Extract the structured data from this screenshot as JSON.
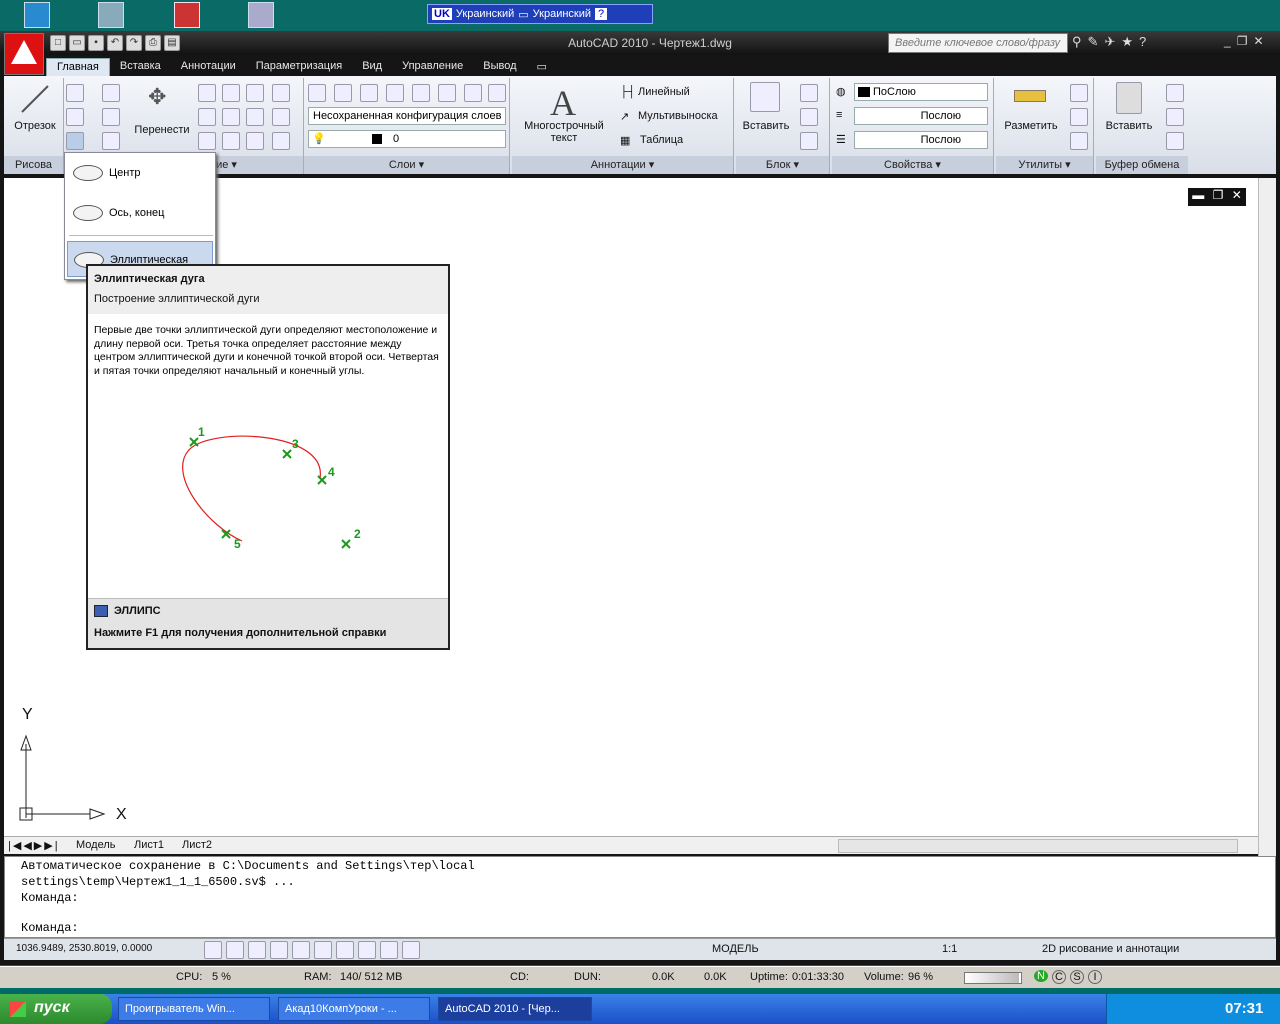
{
  "lang_bar": {
    "code": "UK",
    "label1": "Украинский",
    "label2": "Украинский",
    "help": "?"
  },
  "window": {
    "title": "AutoCAD 2010 - Чертеж1.dwg",
    "search_placeholder": "Введите ключевое слово/фразу",
    "min": "_",
    "restore": "❐",
    "close": "✕"
  },
  "tabs": [
    "Главная",
    "Вставка",
    "Аннотации",
    "Параметризация",
    "Вид",
    "Управление",
    "Вывод"
  ],
  "ribbon": {
    "draw": {
      "line": "Отрезок",
      "footer": "Рисова"
    },
    "modify": {
      "move": "Перенести",
      "footer": "ование ▾"
    },
    "layers": {
      "layer_state": "Несохраненная конфигурация слоев",
      "current_layer": "0",
      "footer": "Слои ▾"
    },
    "annotation": {
      "mtext": "Многострочный текст",
      "linear": "Линейный",
      "multileader": "Мультивыноска",
      "table": "Таблица",
      "footer": "Аннотации ▾"
    },
    "block": {
      "insert": "Вставить",
      "footer": "Блок ▾"
    },
    "properties": {
      "color": "ПоСлою",
      "linetype": "Послою",
      "lineweight": "Послою",
      "footer": "Свойства ▾"
    },
    "utilities": {
      "measure": "Разметить",
      "footer": "Утилиты ▾"
    },
    "clipboard": {
      "paste": "Вставить",
      "footer": "Буфер обмена"
    }
  },
  "ellipse_menu": [
    "Центр",
    "Ось, конец",
    "Эллиптическая дуга"
  ],
  "tooltip": {
    "title": "Эллиптическая дуга",
    "subtitle": "Построение эллиптической дуги",
    "body": "Первые две точки эллиптической дуги определяют местоположение и длину первой оси. Третья точка определяет расстояние между центром эллиптической дуги и конечной точкой второй оси. Четвертая и пятая точки определяют начальный и конечный углы.",
    "points": [
      "1",
      "2",
      "3",
      "4",
      "5"
    ],
    "command": "ЭЛЛИПС",
    "help": "Нажмите F1 для получения дополнительной справки"
  },
  "ucs": {
    "x": "X",
    "y": "Y"
  },
  "layout_tabs": [
    "Модель",
    "Лист1",
    "Лист2"
  ],
  "command_lines": [
    "Автоматическое сохранение в C:\\Documents and Settings\\тер\\local",
    "settings\\temp\\Чертеж1_1_1_6500.sv$ ...",
    "Команда:",
    "Команда:"
  ],
  "status": {
    "coords": "1036.9489, 2530.8019, 0.0000",
    "model": "МОДЕЛЬ",
    "scale": "1:1",
    "workspace": "2D рисование и аннотации"
  },
  "meter": {
    "cpu_label": "CPU:",
    "cpu_value": "5 %",
    "ram_label": "RAM:",
    "ram_value": "140/ 512 MB",
    "cd": "CD:",
    "dun": "DUN:",
    "down": "0.0K",
    "up": "0.0K",
    "uptime_label": "Uptime:",
    "uptime": "0:01:33:30",
    "volume_label": "Volume:",
    "volume": "96 %",
    "n": "N",
    "c": "C",
    "s": "S",
    "i": "I"
  },
  "taskbar": {
    "start": "пуск",
    "tasks": [
      "Проигрыватель Win...",
      "Акад10КомпУроки - ...",
      "AutoCAD 2010 - [Чер..."
    ],
    "clock": "07:31"
  }
}
